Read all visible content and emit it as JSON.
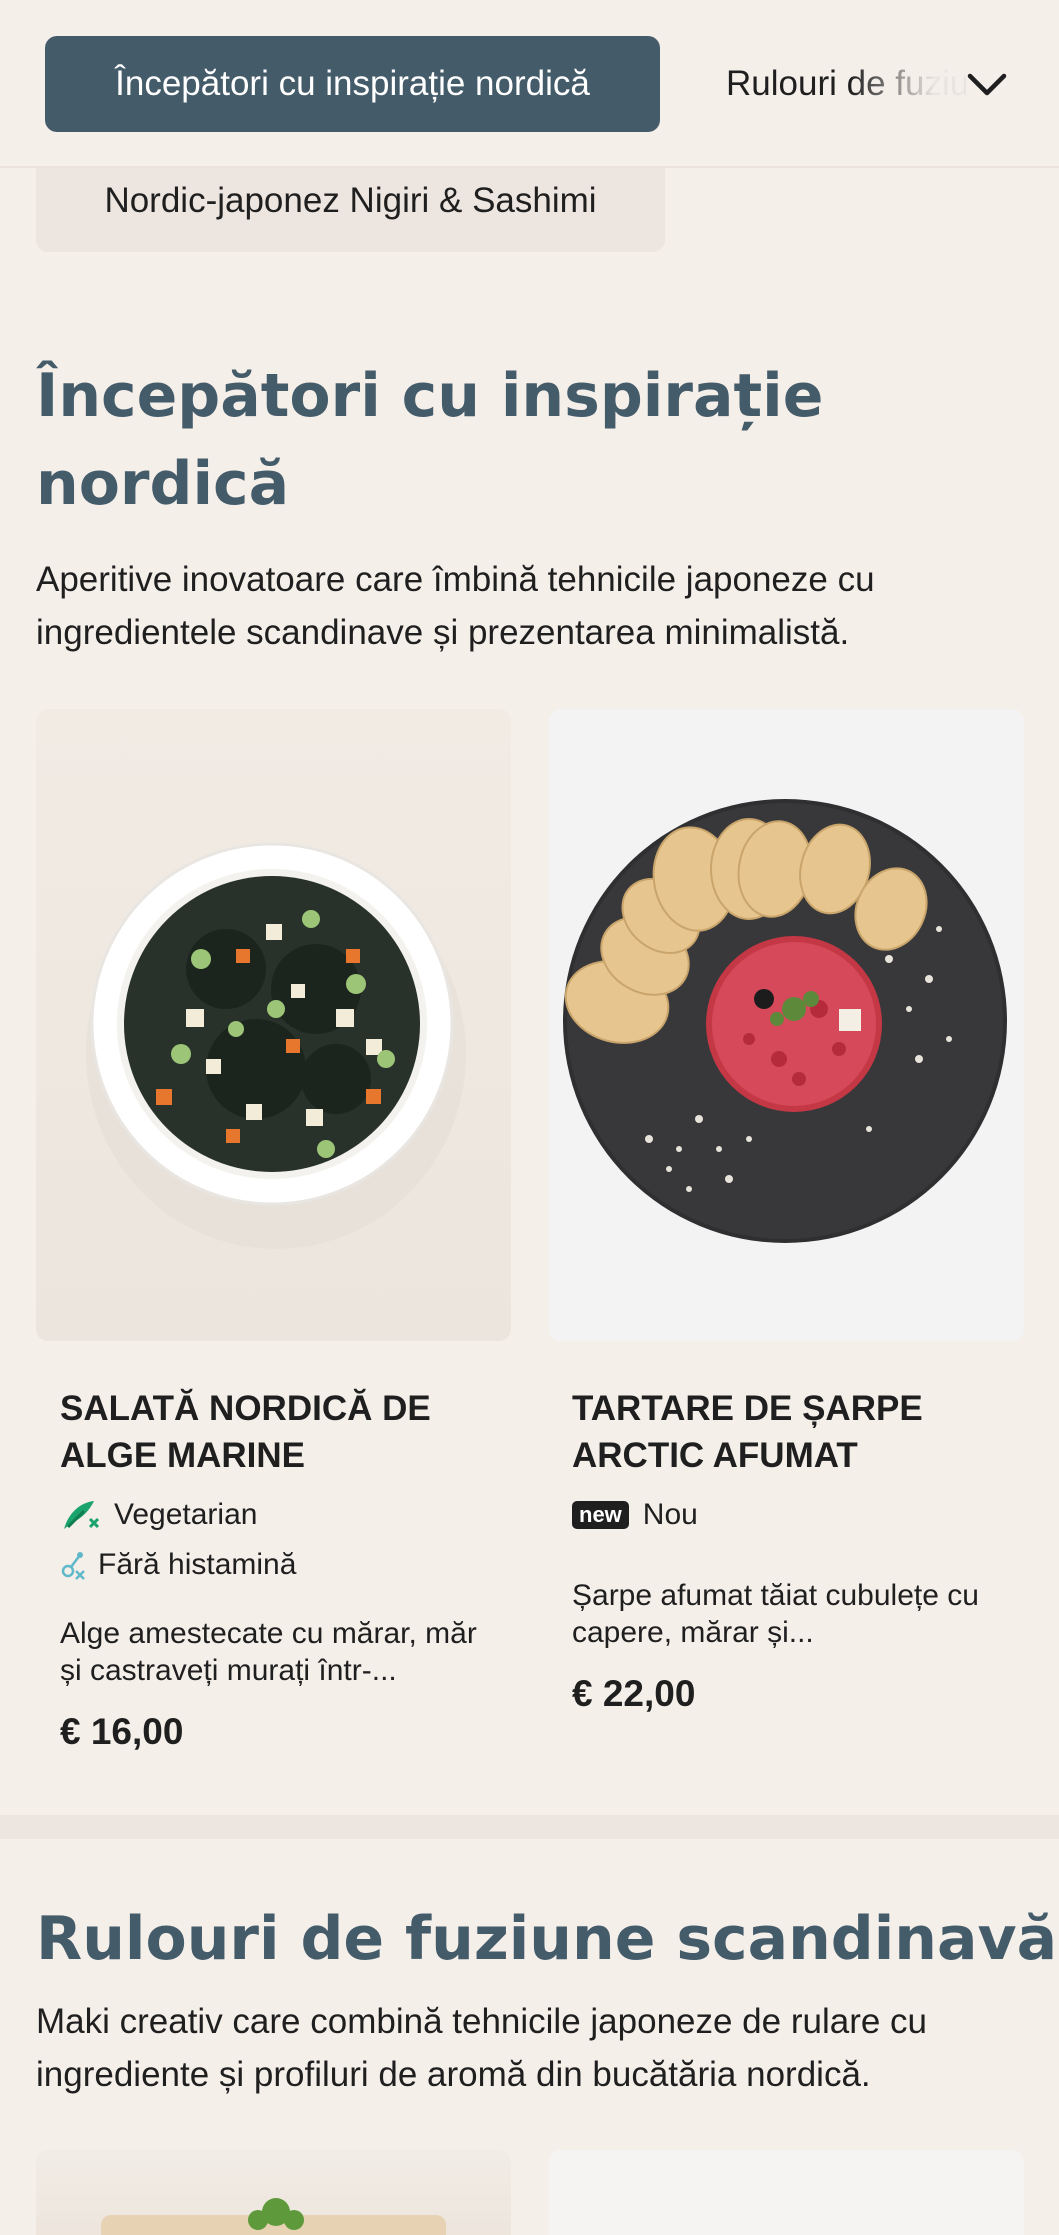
{
  "category_bar": {
    "active": "Începători cu inspirație nordică",
    "next": "Rulouri de fuziune scandinavă",
    "below": "Nordic-japonez Nigiri & Sashimi"
  },
  "sections": [
    {
      "title": "Începători cu inspirație nordică",
      "description": "Aperitive inovatoare care îmbină tehnicile japoneze cu ingredientele scandinave și prezentarea minimalistă.",
      "items": [
        {
          "name": "SALATĂ NORDICĂ DE ALGE MARINE",
          "tags": [
            "Vegetarian",
            "Fără histamină"
          ],
          "description": "Alge amestecate cu mărar, măr și castraveți murați într-...",
          "price": "€ 16,00",
          "image_icon": "seaweed-salad-bowl-image"
        },
        {
          "name": "TARTARE DE ȘARPE ARCTIC AFUMAT",
          "badge": "new",
          "badge_label": "Nou",
          "description": "Șarpe afumat tăiat cubulețe cu capere, mărar și...",
          "price": "€ 22,00",
          "image_icon": "tartare-plate-image"
        }
      ]
    },
    {
      "title": "Rulouri de fuziune scandinavă",
      "description": "Maki creativ care combină tehnicile japoneze de rulare cu ingrediente și profiluri de aromă din bucătăria nordică."
    }
  ],
  "colors": {
    "background": "#f5efea",
    "accent": "#445b6a",
    "vegetarian_icon": "#1aa36b",
    "histamine_icon": "#5fb8c9"
  }
}
